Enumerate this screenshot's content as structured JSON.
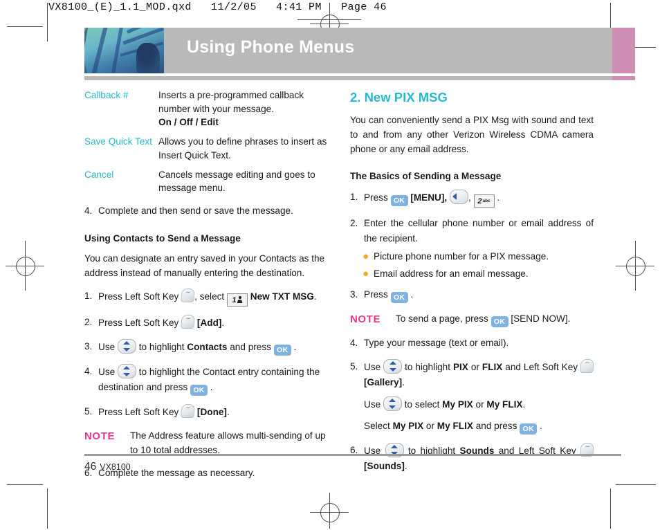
{
  "file_header": "VX8100_(E)_1.1_MOD.qxd   11/2/05   4:41 PM   Page 46",
  "banner": {
    "title": "Using Phone Menus"
  },
  "footer": {
    "page_number": "46",
    "model": "VX8100"
  },
  "colors": {
    "accent_cyan": "#27b9cc",
    "note_pink": "#e8368f",
    "bullet_orange": "#f5a623",
    "banner_gray": "#b9b9b9",
    "tab_pink": "#cf8fb5",
    "ok_key_blue": "#7fb2e0"
  },
  "left_column": {
    "definitions": [
      {
        "term": "Callback #",
        "lines": [
          "Inserts a pre-programmed callback",
          "number with your message."
        ],
        "options": "On / Off / Edit"
      },
      {
        "term": "Save Quick Text",
        "lines": [
          "Allows you to define phrases to insert as",
          "Insert Quick Text."
        ],
        "options": ""
      },
      {
        "term": "Cancel",
        "lines": [
          "Cancels message editing and goes to",
          "message menu."
        ],
        "options": ""
      }
    ],
    "step4": {
      "num": "4.",
      "text": "Complete and then send or save the message."
    },
    "subhead": "Using Contacts to Send a Message",
    "intro": "You can designate an entry saved in your Contacts as the address instead of manually entering the destination.",
    "steps": [
      {
        "num": "1.",
        "pre": "Press Left Soft Key",
        "mid": ", select",
        "key_digit": "1",
        "post_bold": "New TXT MSG",
        "post": "."
      },
      {
        "num": "2.",
        "pre": "Press Left Soft Key",
        "bracket": "[Add]",
        "post": "."
      },
      {
        "num": "3.",
        "pre": "Use",
        "mid": "to highlight",
        "bold": "Contacts",
        "mid2": "and press",
        "post": "."
      },
      {
        "num": "4.",
        "pre": "Use",
        "mid": "to highlight the Contact entry containing the destination and press",
        "post": "."
      },
      {
        "num": "5.",
        "pre": "Press  Left Soft Key",
        "bracket": "[Done]",
        "post": "."
      }
    ],
    "note": {
      "label": "NOTE",
      "text": "The Address feature allows multi-sending of up to 10 total addresses."
    },
    "step6": {
      "num": "6.",
      "text": "Complete the message as necessary."
    }
  },
  "right_column": {
    "heading": "2. New PIX MSG",
    "intro": "You can conveniently send a PIX Msg with sound and text to and from any other Verizon Wireless CDMA camera phone or any email address.",
    "subhead": "The Basics of Sending a Message",
    "step1": {
      "num": "1.",
      "pre": "Press",
      "bracket": "[MENU],",
      "comma": ",",
      "key_digit": "2",
      "key_sub": "abc",
      "post": "."
    },
    "step2": {
      "num": "2.",
      "text": "Enter the cellular phone number or email address of the recipient."
    },
    "bullets": [
      "Picture phone number for a PIX message.",
      "Email address for an email message."
    ],
    "step3": {
      "num": "3.",
      "pre": "Press",
      "post": "."
    },
    "note": {
      "label": "NOTE",
      "pre": "To send a page, press",
      "post": "[SEND NOW]."
    },
    "step4": {
      "num": "4.",
      "text": "Type your message (text or email)."
    },
    "step5": {
      "num": "5.",
      "pre": "Use",
      "mid": "to highlight",
      "bold1": "PIX",
      "or1": "or",
      "bold2": "FLIX",
      "mid2": "and Left Soft Key",
      "bracket": "[Gallery]",
      "dot": ".",
      "line2_pre": "Use",
      "line2_mid": "to select",
      "line2_bold1": "My PIX",
      "line2_or": "or",
      "line2_bold2": "My FLIX",
      "line2_end": ".",
      "line3_pre": "Select",
      "line3_bold1": "My PIX",
      "line3_or": "or",
      "line3_bold2": "My FLIX",
      "line3_mid": "and press",
      "line3_end": "."
    },
    "step6": {
      "num": "6.",
      "pre": "Use",
      "mid": "to highlight",
      "bold": "Sounds",
      "mid2": "and Left Soft Key",
      "bracket": "[Sounds]",
      "dot": "."
    }
  },
  "icons": {
    "ok_key": "OK",
    "soft_key": "left-soft-key",
    "nav_updown": "nav-updown-key",
    "nav_left": "nav-left-key",
    "reg_mark": "registration-mark"
  }
}
